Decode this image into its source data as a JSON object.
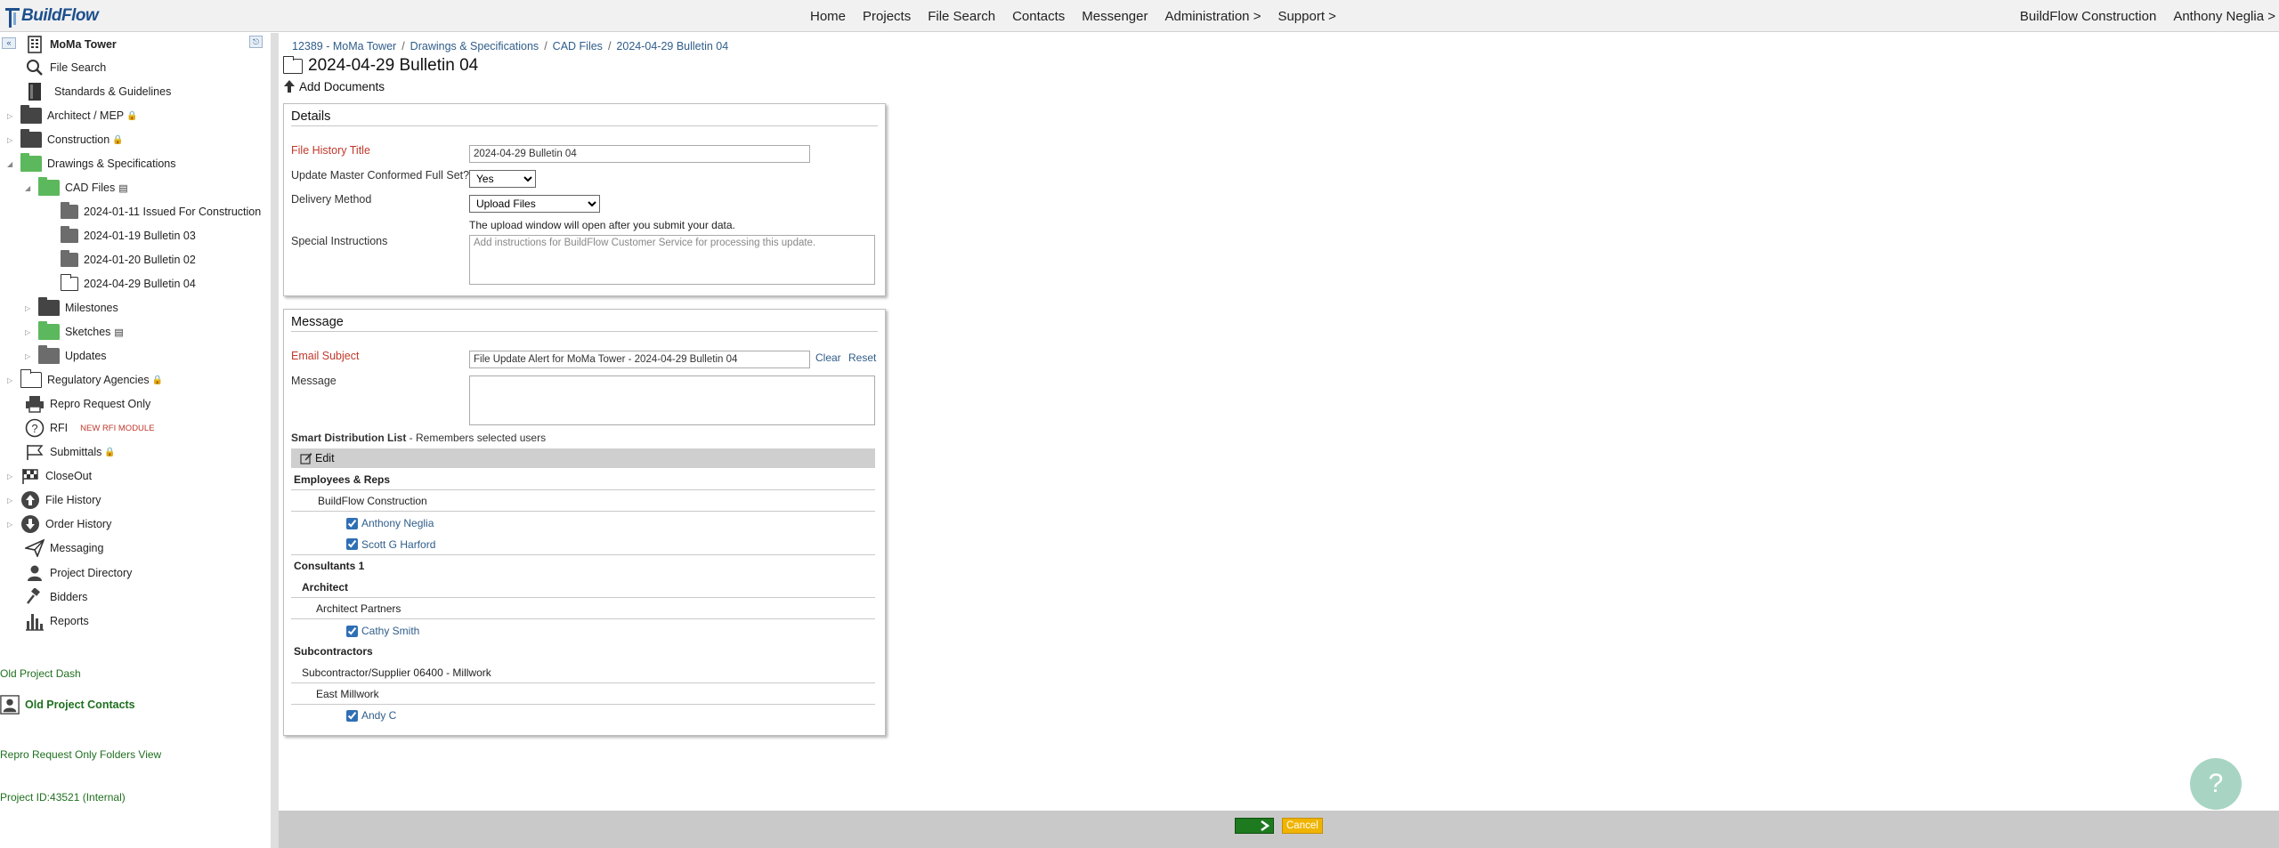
{
  "brand": {
    "name": "BuildFlow"
  },
  "nav": {
    "items": [
      "Home",
      "Projects",
      "File Search",
      "Contacts",
      "Messenger",
      "Administration >",
      "Support >"
    ],
    "company": "BuildFlow Construction",
    "user": "Anthony Neglia >"
  },
  "sidebar": {
    "project_name": "MoMa Tower",
    "file_search": "File Search",
    "standards": "Standards & Guidelines",
    "architect_mep": "Architect / MEP",
    "construction": "Construction",
    "drawings": "Drawings & Specifications",
    "cad_files": "CAD Files",
    "cad_children": [
      "2024-01-11 Issued For Construction",
      "2024-01-19 Bulletin 03",
      "2024-01-20 Bulletin 02",
      "2024-04-29 Bulletin 04"
    ],
    "milestones": "Milestones",
    "sketches": "Sketches",
    "updates": "Updates",
    "regulatory": "Regulatory Agencies",
    "repro": "Repro Request Only",
    "rfi": "RFI",
    "rfi_badge": "NEW RFI MODULE",
    "submittals": "Submittals",
    "closeout": "CloseOut",
    "file_history": "File History",
    "order_history": "Order History",
    "messaging": "Messaging",
    "project_directory": "Project Directory",
    "bidders": "Bidders",
    "reports": "Reports",
    "old_dash": "Old Project Dash",
    "old_contacts": "Old Project Contacts",
    "repro_folders_view": "Repro Request Only Folders View",
    "project_id": "Project ID:43521 (Internal)"
  },
  "breadcrumb": [
    "12389 - MoMa Tower",
    "Drawings & Specifications",
    "CAD Files",
    "2024-04-29 Bulletin 04"
  ],
  "page": {
    "title": "2024-04-29 Bulletin 04",
    "add_documents": "Add Documents"
  },
  "details": {
    "heading": "Details",
    "title_label": "File History Title",
    "title_value": "2024-04-29 Bulletin 04",
    "update_label": "Update Master Conformed Full Set?",
    "update_value": "Yes",
    "delivery_label": "Delivery Method",
    "delivery_value": "Upload Files",
    "upload_hint": "The upload window will open after you submit your data.",
    "instructions_label": "Special Instructions",
    "instructions_placeholder": "Add instructions for BuildFlow Customer Service for processing this update."
  },
  "message": {
    "heading": "Message",
    "subject_label": "Email Subject",
    "subject_value": "File Update Alert for MoMa Tower - 2024-04-29 Bulletin 04",
    "clear": "Clear",
    "reset": "Reset",
    "message_label": "Message",
    "smart_list_title": "Smart Distribution List",
    "smart_list_note": " - Remembers selected users",
    "edit": "Edit",
    "employees_heading": "Employees & Reps",
    "employees_company": "BuildFlow Construction",
    "employees": [
      "Anthony Neglia",
      "Scott G Harford"
    ],
    "consultants_heading": "Consultants 1",
    "architect_heading": "Architect",
    "architect_company": "Architect Partners",
    "architects": [
      "Cathy Smith"
    ],
    "subcontractors_heading": "Subcontractors",
    "sub_group": "Subcontractor/Supplier 06400 - Millwork",
    "sub_company": "East Millwork",
    "subs": [
      "Andy C"
    ]
  },
  "footer": {
    "cancel": "Cancel"
  },
  "help": {
    "label": "?"
  },
  "colors": {
    "accent": "#2f5d8a",
    "required": "#c0392b",
    "folder_green": "#5cb85c",
    "next_green": "#1e7a1e",
    "cancel_yellow": "#f0b400"
  }
}
